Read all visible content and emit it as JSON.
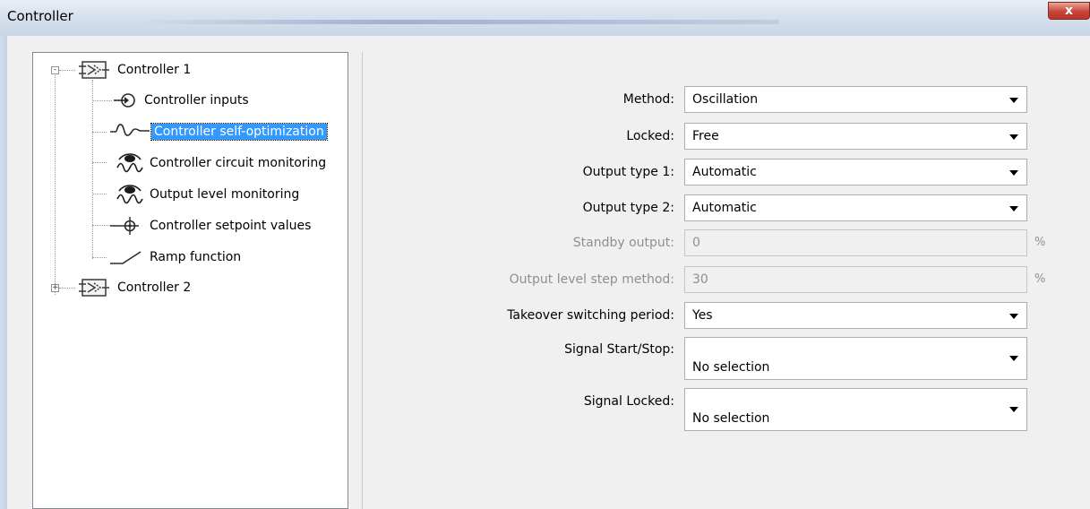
{
  "window": {
    "title": "Controller",
    "close_glyph": "x"
  },
  "tree": [
    {
      "label": "Controller 1",
      "icon": "controller-block-icon",
      "expander": "-",
      "selected": false
    },
    {
      "label": "Controller inputs",
      "icon": "controller-inputs-icon",
      "selected": false
    },
    {
      "label": "Controller self-optimization",
      "icon": "self-optimization-wave-icon",
      "selected": true
    },
    {
      "label": "Controller circuit monitoring",
      "icon": "eye-wave-icon",
      "selected": false
    },
    {
      "label": "Output level monitoring",
      "icon": "eye-wave-icon",
      "selected": false
    },
    {
      "label": "Controller setpoint values",
      "icon": "setpoint-crosshair-icon",
      "selected": false
    },
    {
      "label": "Ramp function",
      "icon": "ramp-icon",
      "selected": false
    },
    {
      "label": "Controller 2",
      "icon": "controller-block-icon",
      "expander": "+",
      "selected": false
    }
  ],
  "form": {
    "method": {
      "label": "Method:",
      "value": "Oscillation"
    },
    "locked": {
      "label": "Locked:",
      "value": "Free"
    },
    "output_type_1": {
      "label": "Output type 1:",
      "value": "Automatic"
    },
    "output_type_2": {
      "label": "Output type 2:",
      "value": "Automatic"
    },
    "standby_output": {
      "label": "Standby output:",
      "value": "0",
      "unit": "%",
      "disabled": true
    },
    "output_level_step": {
      "label": "Output level step method:",
      "value": "30",
      "unit": "%",
      "disabled": true
    },
    "takeover": {
      "label": "Takeover switching period:",
      "value": "Yes"
    },
    "signal_start_stop": {
      "label": "Signal Start/Stop:",
      "value": "No selection"
    },
    "signal_locked": {
      "label": "Signal Locked:",
      "value": "No selection"
    }
  },
  "colors": {
    "selection": "#3399ff",
    "close_button": "#c9453a",
    "titlebar": "#d7e1ee"
  }
}
